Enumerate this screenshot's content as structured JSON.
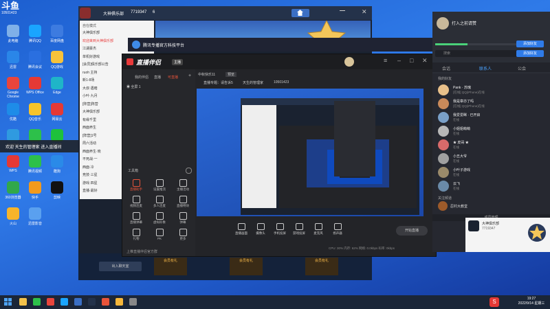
{
  "desktop": {
    "topleft_brand": "斗鱼",
    "topleft_id": "10501423",
    "icons": [
      {
        "label": "此电脑",
        "color": "#7fb0e8"
      },
      {
        "label": "腾讯QQ",
        "color": "#1aa5ff"
      },
      {
        "label": "百度网盘",
        "color": "#3d7be0"
      },
      {
        "label": "迅雷",
        "color": "#2a86e8"
      },
      {
        "label": "腾讯会议",
        "color": "#2a6fe0"
      },
      {
        "label": "QQ游戏",
        "color": "#f7c23a"
      },
      {
        "label": "Google Chrome",
        "color": "#e8453c"
      },
      {
        "label": "WPS Office",
        "color": "#e53935"
      },
      {
        "label": "Edge",
        "color": "#1fb5c8"
      },
      {
        "label": "优酷",
        "color": "#1e8ce8"
      },
      {
        "label": "QQ音乐",
        "color": "#f7c42a"
      },
      {
        "label": "网易云",
        "color": "#e53935"
      },
      {
        "label": "360安全",
        "color": "#2f9ae0"
      },
      {
        "label": "微信",
        "color": "#2dc04a"
      },
      {
        "label": "爱奇艺",
        "color": "#1ec13b"
      },
      {
        "label": "WPS",
        "color": "#e53935"
      },
      {
        "label": "腾讯视频",
        "color": "#2dc04a"
      },
      {
        "label": "酷狗",
        "color": "#2a8ae8"
      },
      {
        "label": "360浏览器",
        "color": "#31a84a"
      },
      {
        "label": "快手",
        "color": "#f29a1d"
      },
      {
        "label": "剪映",
        "color": "#111111"
      },
      {
        "label": "火山",
        "color": "#f7b42a"
      },
      {
        "label": "迅雷影音",
        "color": "#5aa0ef"
      }
    ]
  },
  "notify": {
    "text": "欢迎 天生的管理家 进入直播间"
  },
  "qq_contact_window": {
    "title": "打入之前请赞",
    "tabs": [
      "会话",
      "联系人",
      "公会"
    ],
    "search_placeholder": "搜索",
    "button1": "添加好友",
    "button2": "添加好友",
    "section": "我的好友",
    "friends": [
      {
        "name": "Pank · 苏瑰",
        "status": "[在线] QQ(iPhone)在线"
      },
      {
        "name": "我是章亦了吗",
        "status": "[在线] QQ(iPhone)在线"
      },
      {
        "name": "我爱爱眯 · 已开启",
        "status": "在线"
      },
      {
        "name": "小姐姐萌萌",
        "status": "在线"
      },
      {
        "name": "★ 皮哥 ★",
        "status": "在线"
      },
      {
        "name": "小丑大爷",
        "status": "在线"
      },
      {
        "name": "小叶子游戏",
        "status": "在线"
      },
      {
        "name": "云飞",
        "status": "在线"
      }
    ],
    "group_section": "关注频道",
    "group_item": "忍村大教堂",
    "footer": "成员管理",
    "tray_title": "大神俱乐部",
    "tray_id": "7719347"
  },
  "game_window": {
    "title": "大神俱乐部",
    "id": "7719347",
    "online": "6",
    "left_label": "自在模式",
    "list_items": [
      "大神俱乐部",
      "欢迎来到大神俱乐部",
      "江湖豪杰",
      "单机好游戏",
      "[会员]俱乐部公告",
      "ruoh 主持",
      "新1-8场",
      "大叔·遇暗",
      "小叶·九月",
      "[阵营]阵营",
      "大神俱乐部",
      "有缘千里",
      "西面养生",
      "[阵营]1号",
      "周六活动",
      "西面养生·晓",
      "不死战·一",
      "西面·冷",
      "竞技·三星",
      "游戏·四星",
      "直播·最好"
    ],
    "bottom_buttons": [
      "会员有礼",
      "会员有礼",
      "会员有礼"
    ],
    "input_placeholder": "出入聊天室"
  },
  "official_window": {
    "title": "腾讯专播官方科技平台"
  },
  "stream_app": {
    "logo": "直播伴侣",
    "tag": "主播",
    "nav": [
      "我的伴侣",
      "直播",
      "可直播"
    ],
    "scene": "全屏 1",
    "source_label": "中秋快乐11",
    "badge": "预览",
    "info": "直播专题：请告诉5",
    "room_label": "天生的管理家",
    "room_id": "10501423",
    "tools_section": "工具箱",
    "tools": [
      {
        "label": "直播助手",
        "color": "#e8543a"
      },
      {
        "label": "设置推流",
        "color": "#cccccc"
      },
      {
        "label": "主播活动",
        "color": "#cccccc"
      },
      {
        "label": "视频连麦",
        "color": "#cccccc"
      },
      {
        "label": "多人连麦",
        "color": "#cccccc"
      },
      {
        "label": "直播特效",
        "color": "#cccccc"
      },
      {
        "label": "直播弹幕",
        "color": "#cccccc"
      },
      {
        "label": "虚拟形象",
        "color": "#cccccc"
      },
      {
        "label": "弹幕",
        "color": "#cccccc"
      },
      {
        "label": "礼物",
        "color": "#cccccc"
      },
      {
        "label": "PK",
        "color": "#cccccc"
      },
      {
        "label": "更多",
        "color": "#cccccc"
      }
    ],
    "bottom_tools": [
      "直播画面",
      "摄像头",
      "手机投屏",
      "游戏投屏",
      "麦克风",
      "扬声器"
    ],
    "start_button": "开始直播",
    "stats": "CPU: 30%  内存: 62%  网络: 0.0kbps  码率: 0kbps",
    "footer_tip": "上推直播伴侣官方群"
  },
  "taskbar": {
    "time": "19:27",
    "date": "2022/9/14 星期三",
    "lang": "中"
  }
}
